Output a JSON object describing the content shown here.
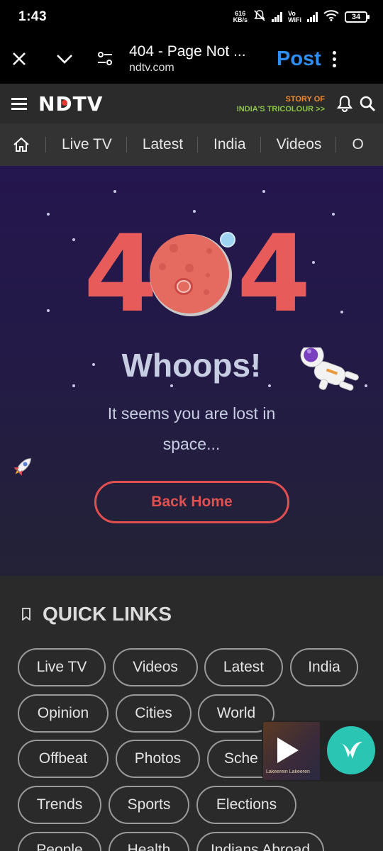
{
  "status_bar": {
    "time": "1:43",
    "net_speed_value": "616",
    "net_speed_unit": "KB/s",
    "vowifi_line1": "Vo",
    "vowifi_line2": "WiFi",
    "battery": "34"
  },
  "browser": {
    "page_title": "404 - Page Not ...",
    "domain": "ndtv.com",
    "post_label": "Post",
    "accent": "#2f8ef2"
  },
  "header": {
    "logo": "NDTV",
    "promo_line1": "STORY OF",
    "promo_line2": "INDIA'S TRICOLOUR >>"
  },
  "nav": {
    "items": [
      "Live TV",
      "Latest",
      "India",
      "Videos",
      "O"
    ]
  },
  "hero": {
    "digit_left": "4",
    "digit_right": "4",
    "headline": "Whoops!",
    "message": "It seems you are lost in space...",
    "button_label": "Back Home",
    "accent": "#e85b5b"
  },
  "quick_links": {
    "title": "QUICK LINKS",
    "links": [
      "Live TV",
      "Videos",
      "Latest",
      "India",
      "Opinion",
      "Cities",
      "World",
      "Offbeat",
      "Photos",
      "Sche",
      "Trends",
      "Sports",
      "Elections",
      "People",
      "Health",
      "Indians Abroad"
    ]
  },
  "player": {
    "thumbnail_text": "Lakeerein Lakeeren"
  }
}
